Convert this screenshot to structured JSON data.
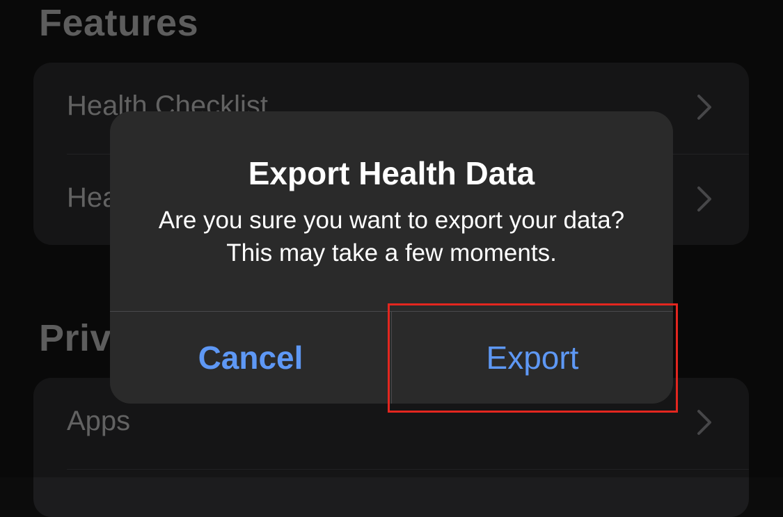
{
  "sections": {
    "features": {
      "title": "Features",
      "rows": [
        {
          "label": "Health Checklist"
        },
        {
          "label": "Health Records"
        }
      ]
    },
    "privacy": {
      "title": "Privacy",
      "rows": [
        {
          "label": "Apps"
        }
      ]
    }
  },
  "alert": {
    "title": "Export Health Data",
    "message": "Are you sure you want to export your data? This may take a few moments.",
    "cancel_label": "Cancel",
    "confirm_label": "Export"
  },
  "icons": {
    "row_chevron": "chevron-right-icon"
  },
  "colors": {
    "accent": "#5e98f5",
    "highlight": "#e3261f",
    "alert_background": "#2a2a2a"
  }
}
